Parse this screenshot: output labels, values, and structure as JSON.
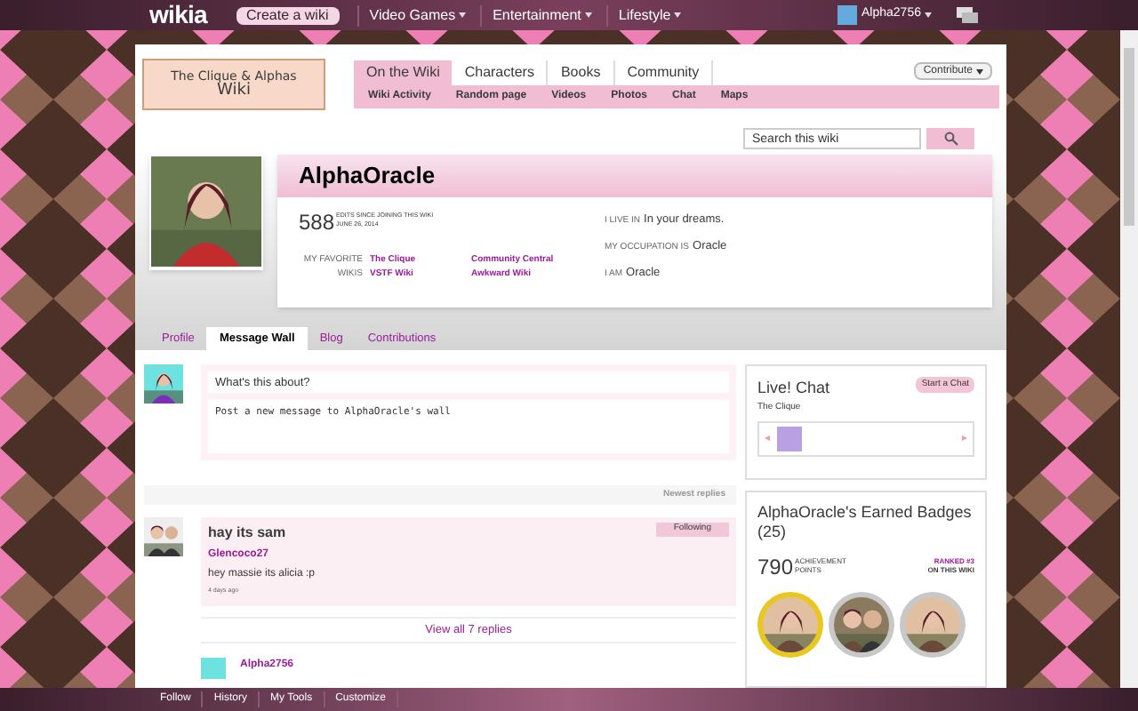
{
  "top_bar": {
    "logo": "wikia",
    "create_button": "Create a wiki",
    "menus": [
      {
        "label": "Video Games"
      },
      {
        "label": "Entertainment"
      },
      {
        "label": "Lifestyle"
      }
    ],
    "user": "Alpha2756"
  },
  "wiki": {
    "logo_title": "The Clique & Alphas",
    "logo_subtitle": "Wiki",
    "tabs": [
      {
        "label": "On the Wiki",
        "selected": true
      },
      {
        "label": "Characters",
        "selected": false
      },
      {
        "label": "Books",
        "selected": false
      },
      {
        "label": "Community",
        "selected": false
      }
    ],
    "subnav": [
      "Wiki Activity",
      "Random page",
      "Videos",
      "Photos",
      "Chat",
      "Maps"
    ],
    "contribute": "Contribute",
    "search": {
      "placeholder": "Search this wiki"
    }
  },
  "profile": {
    "name": "AlphaOracle",
    "edits": "588",
    "edits_label": "EDITS SINCE JOINING THIS WIKI",
    "joined": "JUNE 26, 2014",
    "favorites_label": "MY FAVORITE WIKIS",
    "favorites": [
      "The Clique",
      "Community Central",
      "VSTF Wiki",
      "Awkward Wiki"
    ],
    "facts": [
      {
        "label": "I LIVE IN",
        "value": "In your dreams."
      },
      {
        "label": "MY OCCUPATION IS",
        "value": "Oracle"
      },
      {
        "label": "I AM",
        "value": "Oracle"
      }
    ]
  },
  "profile_tabs": [
    {
      "label": "Profile",
      "selected": false
    },
    {
      "label": "Message Wall",
      "selected": true
    },
    {
      "label": "Blog",
      "selected": false
    },
    {
      "label": "Contributions",
      "selected": false
    }
  ],
  "wall": {
    "title_placeholder": "What's this about?",
    "body_placeholder": "Post a new message to AlphaOracle's wall",
    "sort": "Newest replies",
    "threads": [
      {
        "title": "hay its sam",
        "follow": "Following",
        "author": "Glencoco27",
        "text": "hey massie its alicia :p",
        "time": "4 days ago",
        "view_all": "View all 7 replies",
        "next_author": "Alpha2756"
      }
    ]
  },
  "chat": {
    "title": "Live! Chat",
    "wiki": "The Clique",
    "button": "Start a Chat",
    "left": "◂",
    "right": "▸"
  },
  "badges": {
    "title": "AlphaOracle's Earned Badges (25)",
    "points": "790",
    "points_label": "ACHIEVEMENT POINTS",
    "rank": "RANKED #3",
    "rank_sub": "ON THIS WIKI"
  },
  "footer": [
    {
      "label": "Follow"
    },
    {
      "label": "History"
    },
    {
      "label": "My Tools"
    },
    {
      "label": "Customize"
    }
  ]
}
